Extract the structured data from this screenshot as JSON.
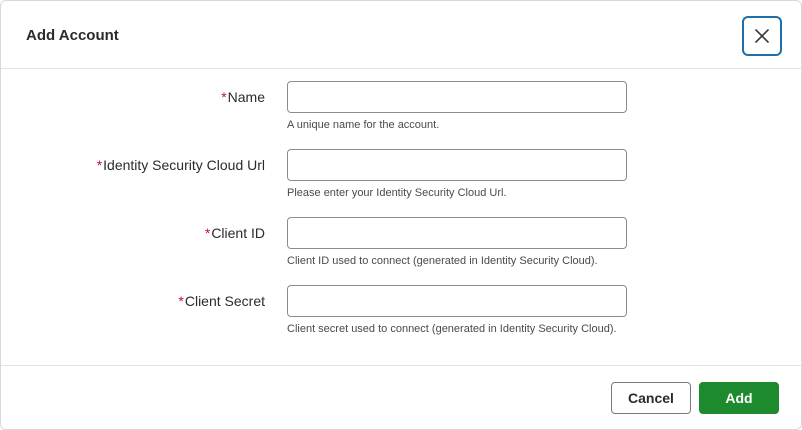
{
  "dialog": {
    "title": "Add Account",
    "close_icon": "close-icon"
  },
  "required_marker": "*",
  "fields": [
    {
      "label": "Name",
      "value": "",
      "placeholder": "",
      "help": "A unique name for the account."
    },
    {
      "label": "Identity Security Cloud Url",
      "value": "",
      "placeholder": "",
      "help": "Please enter your Identity Security Cloud Url."
    },
    {
      "label": "Client ID",
      "value": "",
      "placeholder": "",
      "help": "Client ID used to connect (generated in Identity Security Cloud)."
    },
    {
      "label": "Client Secret",
      "value": "",
      "placeholder": "",
      "help": "Client secret used to connect (generated in Identity Security Cloud)."
    }
  ],
  "footer": {
    "cancel_label": "Cancel",
    "add_label": "Add"
  },
  "colors": {
    "primary_button": "#1e8a2e",
    "required_marker": "#c8102e",
    "focus_ring": "#1f6fa8"
  }
}
